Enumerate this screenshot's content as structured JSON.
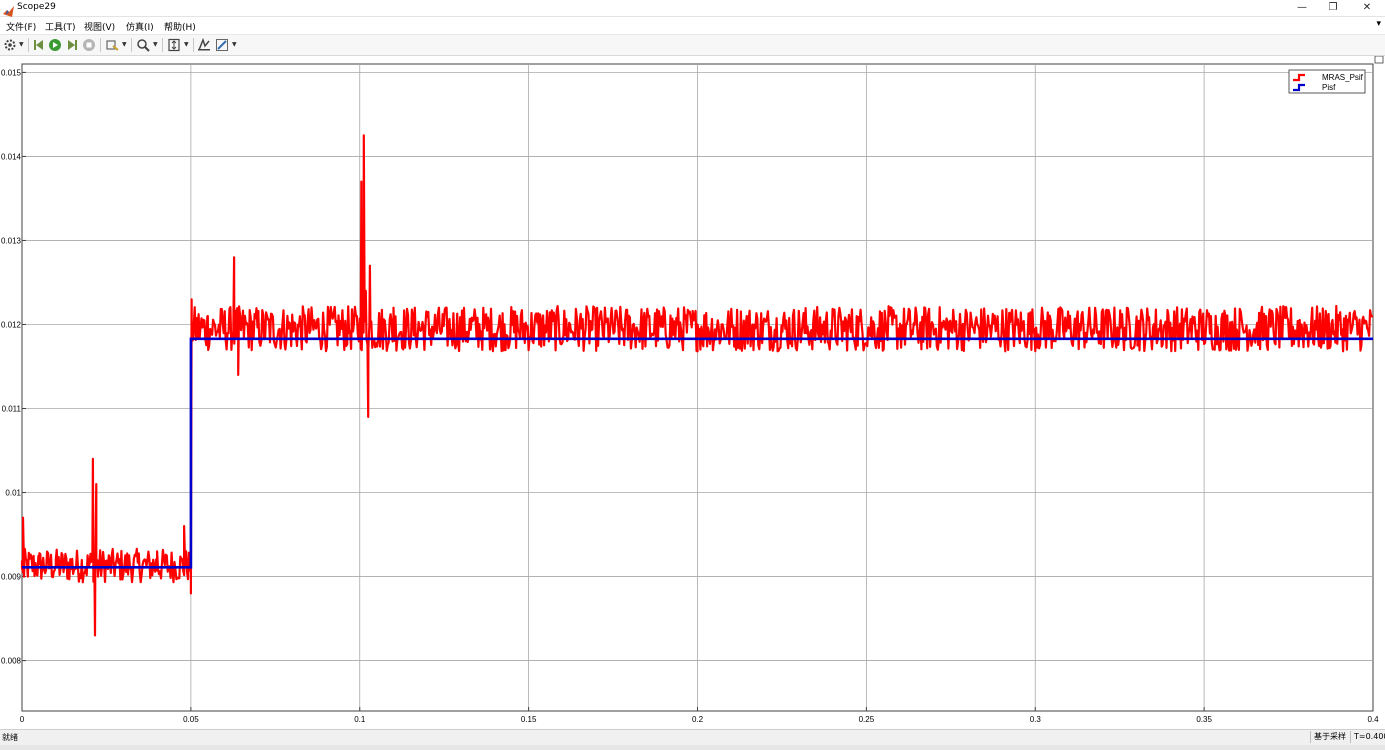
{
  "window": {
    "title": "Scope29"
  },
  "menu": {
    "items": [
      "文件(F)",
      "工具(T)",
      "视图(V)",
      "仿真(I)",
      "帮助(H)"
    ]
  },
  "toolbar": {
    "icons": [
      "settings-icon",
      "step-back-icon",
      "run-icon",
      "step-forward-icon",
      "stop-icon",
      "highlight-icon",
      "zoom-icon",
      "fit-icon",
      "scale-icon",
      "style-icon"
    ]
  },
  "status": {
    "left": "就绪",
    "mode": "基于采样",
    "time": "T=0.400"
  },
  "chart_data": {
    "type": "line",
    "title": "",
    "xlabel": "",
    "ylabel": "",
    "xlim": [
      0,
      0.4
    ],
    "ylim": [
      0.0074,
      0.0151
    ],
    "xticks": [
      0,
      0.05,
      0.1,
      0.15,
      0.2,
      0.25,
      0.3,
      0.35,
      0.4
    ],
    "xtick_labels": [
      "0",
      "0.05",
      "0.1",
      "0.15",
      "0.2",
      "0.25",
      "0.3",
      "0.35",
      "0.4"
    ],
    "yticks": [
      0.008,
      0.009,
      0.01,
      0.011,
      0.012,
      0.013,
      0.014,
      0.015
    ],
    "ytick_labels": [
      "0.008",
      "0.009",
      "0.01",
      "0.011",
      "0.012",
      "0.013",
      "0.014",
      "0.015"
    ],
    "grid": true,
    "legend_position": "top-right",
    "series": [
      {
        "name": "MRAS_Psif",
        "color": "#ff0000",
        "style": "noisy",
        "segments": [
          {
            "x_start": 0,
            "x_end": 0.05,
            "mean": 0.00913,
            "amplitude": 0.0002
          },
          {
            "x_start": 0.05,
            "x_end": 0.4,
            "mean": 0.01195,
            "amplitude": 0.00027
          }
        ],
        "points": [
          [
            0,
            0.0091
          ],
          [
            0.0003,
            0.0097
          ],
          [
            0.0006,
            0.009
          ],
          [
            0.005,
            0.00915
          ],
          [
            0.01,
            0.0092
          ],
          [
            0.021,
            0.0104
          ],
          [
            0.0213,
            0.0092
          ],
          [
            0.0216,
            0.0083
          ],
          [
            0.022,
            0.0101
          ],
          [
            0.0225,
            0.009
          ],
          [
            0.04,
            0.0093
          ],
          [
            0.048,
            0.0096
          ],
          [
            0.05,
            0.0088
          ],
          [
            0.0502,
            0.0123
          ],
          [
            0.055,
            0.0121
          ],
          [
            0.0628,
            0.0128
          ],
          [
            0.064,
            0.0114
          ],
          [
            0.07,
            0.0121
          ],
          [
            0.1005,
            0.0137
          ],
          [
            0.1012,
            0.01425
          ],
          [
            0.1018,
            0.0124
          ],
          [
            0.1025,
            0.0109
          ],
          [
            0.103,
            0.0127
          ],
          [
            0.11,
            0.0122
          ],
          [
            0.2,
            0.012
          ],
          [
            0.3,
            0.01195
          ],
          [
            0.4,
            0.0121
          ]
        ]
      },
      {
        "name": "Pisf",
        "color": "#0000cc",
        "style": "step",
        "points": [
          [
            0,
            0.00911
          ],
          [
            0.05,
            0.00911
          ],
          [
            0.05,
            0.01183
          ],
          [
            0.4,
            0.01183
          ]
        ]
      }
    ]
  }
}
